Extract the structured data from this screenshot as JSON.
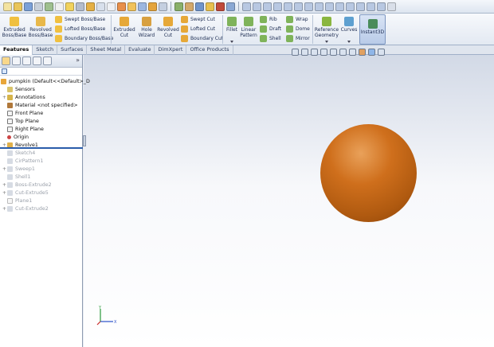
{
  "colors": {
    "accent": "#2a5caa",
    "pumpkin": "#c8661a",
    "ribbon_text": "#1a2a50"
  },
  "ribbon": {
    "extruded_boss": "Extruded\nBoss/Base",
    "revolved_boss": "Revolved\nBoss/Base",
    "swept_boss": "Swept Boss/Base",
    "lofted_boss": "Lofted Boss/Base",
    "boundary_boss": "Boundary Boss/Base",
    "extruded_cut": "Extruded\nCut",
    "hole_wizard": "Hole\nWizard",
    "revolved_cut": "Revolved\nCut",
    "swept_cut": "Swept Cut",
    "lofted_cut": "Lofted Cut",
    "boundary_cut": "Boundary Cut",
    "fillet": "Fillet",
    "linear_pattern": "Linear\nPattern",
    "rib": "Rib",
    "draft": "Draft",
    "shell": "Shell",
    "wrap": "Wrap",
    "dome": "Dome",
    "mirror": "Mirror",
    "reference_geometry": "Reference\nGeometry",
    "curves": "Curves",
    "instant3d": "Instant3D"
  },
  "tabs": [
    "Features",
    "Sketch",
    "Surfaces",
    "Sheet Metal",
    "Evaluate",
    "DimXpert",
    "Office Products"
  ],
  "tree": {
    "root": "pumpkin  (Default<<Default>_D",
    "items": [
      {
        "label": "Sensors",
        "dim": false
      },
      {
        "label": "Annotations",
        "dim": false
      },
      {
        "label": "Material <not specified>",
        "dim": false
      },
      {
        "label": "Front Plane",
        "dim": false
      },
      {
        "label": "Top Plane",
        "dim": false
      },
      {
        "label": "Right Plane",
        "dim": false
      },
      {
        "label": "Origin",
        "dim": false
      },
      {
        "label": "Revolve1",
        "dim": false
      },
      {
        "label": "Sketch4",
        "dim": true
      },
      {
        "label": "CirPattern1",
        "dim": true
      },
      {
        "label": "Sweep1",
        "dim": true
      },
      {
        "label": "Shell1",
        "dim": true
      },
      {
        "label": "Boss-Extrude2",
        "dim": true
      },
      {
        "label": "Cut-Extrude5",
        "dim": true
      },
      {
        "label": "Plane1",
        "dim": true
      },
      {
        "label": "Cut-Extrude2",
        "dim": true
      }
    ]
  },
  "triad": {
    "x_label": "X",
    "y_label": "Y"
  }
}
